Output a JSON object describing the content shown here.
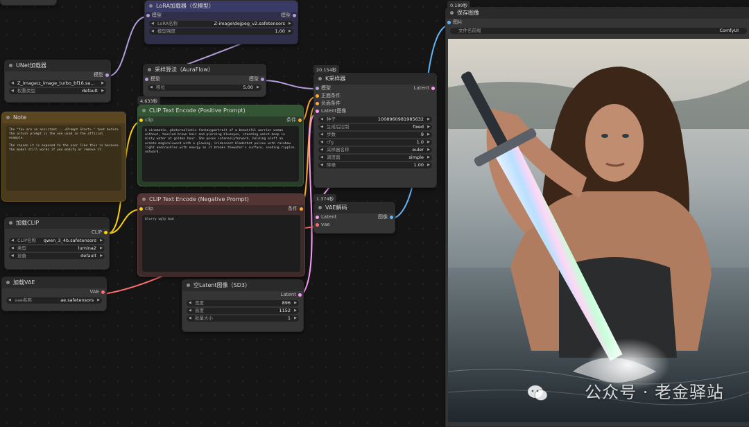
{
  "badges": {
    "ksampler_time": "20.154秒",
    "clip_pos_time": "4.633秒",
    "vae_decode_time": "1.374秒",
    "save_time": "0.189秒"
  },
  "lora_node": {
    "title": "LoRA加载器（仅模型）",
    "in_label": "模型",
    "out_label": "模型",
    "widgets": [
      {
        "label": "LoRA名称",
        "value": "Z-image\\dejpeg_v2.safetensors"
      },
      {
        "label": "模型强度",
        "value": "1.00"
      }
    ]
  },
  "unet_node": {
    "title": "UNet加载器",
    "out_label": "模型",
    "widgets": [
      {
        "label": "",
        "value": "Z_Image\\z_image_turbo_bf16.sa..."
      },
      {
        "label": "权重类型",
        "value": "default"
      }
    ]
  },
  "sampling_node": {
    "title": "采样算法（AuraFlow）",
    "in_label": "模型",
    "out_label": "模型",
    "widgets": [
      {
        "label": "移位",
        "value": "5.00"
      }
    ]
  },
  "note_node": {
    "title": "Note",
    "text_1": "The \"You are an assistant... <Prompt Start> \" text before the actual prompt is the one used in the official example.",
    "text_2": "The reason it is exposed to the user like this is because the model still works if you modify or remove it."
  },
  "clip_pos_node": {
    "title": "CLIP Text Encode (Positive Prompt)",
    "in_label": "clip",
    "out_label": "条件",
    "text": "A cinematic, photorealistic fantasyportrait of a beautiful warrior woman without, tousled brown hair and piercing blueeyes, standing waist-deep in misty water at golden hour. She poses intenselyforward, holding aloft an ornate magicalsword with a glowing, iridescent bladethat pulses with rainbow light andcrackles with energy as it breaks thewater's surface, sending ripples outward."
  },
  "clip_neg_node": {
    "title": "CLIP Text Encode (Negative Prompt)",
    "in_label": "clip",
    "out_label": "条件",
    "text": "blurry ugly bad"
  },
  "ksampler_node": {
    "title": "K采样器",
    "inputs": [
      "模型",
      "正面条件",
      "负面条件",
      "Latent图像"
    ],
    "out_label": "Latent",
    "widgets": [
      {
        "label": "种子",
        "value": "1008960981985632"
      },
      {
        "label": "生成后控制",
        "value": "fixed"
      },
      {
        "label": "步数",
        "value": "9"
      },
      {
        "label": "cfg",
        "value": "1.0"
      },
      {
        "label": "采样器名称",
        "value": "euler"
      },
      {
        "label": "调度器",
        "value": "simple"
      },
      {
        "label": "降噪",
        "value": "1.00"
      }
    ]
  },
  "vae_decode_node": {
    "title": "VAE解码",
    "inputs": [
      "Latent",
      "vae"
    ],
    "out_label": "图像"
  },
  "clip_loader_node": {
    "title": "加载CLIP",
    "out_label": "CLIP",
    "widgets": [
      {
        "label": "CLIP名称",
        "value": "qwen_3_4b.safetensors"
      },
      {
        "label": "类型",
        "value": "lumina2"
      },
      {
        "label": "设备",
        "value": "default"
      }
    ]
  },
  "vae_loader_node": {
    "title": "加载VAE",
    "out_label": "VAE",
    "widgets": [
      {
        "label": "vae名称",
        "value": "ae.safetensors"
      }
    ]
  },
  "latent_node": {
    "title": "空Latent图像（SD3）",
    "out_label": "Latent",
    "widgets": [
      {
        "label": "宽度",
        "value": "896"
      },
      {
        "label": "高度",
        "value": "1152"
      },
      {
        "label": "批量大小",
        "value": "1"
      }
    ]
  },
  "save_node": {
    "title": "保存图像",
    "in_label": "图片",
    "widgets": [
      {
        "label": "文件名前缀",
        "value": "ComfyUI"
      }
    ]
  },
  "watermark": "公众号 · 老金驿站",
  "colors": {
    "model_wire": "#b39ddb",
    "clip_wire": "#ffd500",
    "cond_wire": "#ffa931",
    "latent_wire": "#ff9cf9",
    "vae_wire": "#ff6e6e",
    "image_wire": "#64b5f6",
    "note_bg": "#4a3b1e",
    "clip_pos_bg": "#2a3d2a",
    "clip_neg_bg": "#3d2a2a",
    "lora_bg": "#2f2f4a"
  }
}
